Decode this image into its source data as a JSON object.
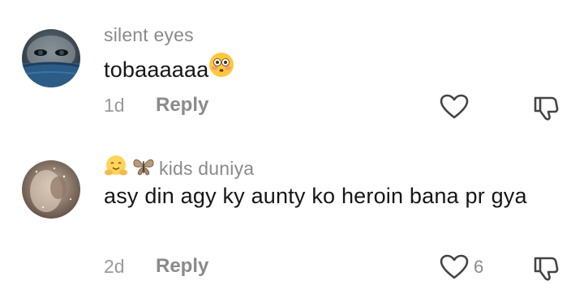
{
  "comments": [
    {
      "username": "silent eyes",
      "text": "tobaaaaaa",
      "time": "1d",
      "reply_label": "Reply",
      "like_count": "",
      "text_emoji": "flushed-face"
    },
    {
      "username": "kids duniya",
      "username_emojis": [
        "hugging-face",
        "butterfly"
      ],
      "text": "asy din agy ky aunty ko heroin bana pr gya",
      "time": "2d",
      "reply_label": "Reply",
      "like_count": "6"
    }
  ],
  "colors": {
    "username": "#8a8a8a",
    "text": "#161616",
    "meta": "#9a9a9a",
    "icon": "#444444",
    "avatar1_bg": "#1a2a3a",
    "avatar1_scarf": "#2b5c86",
    "avatar2_bg": "#7a6558"
  }
}
